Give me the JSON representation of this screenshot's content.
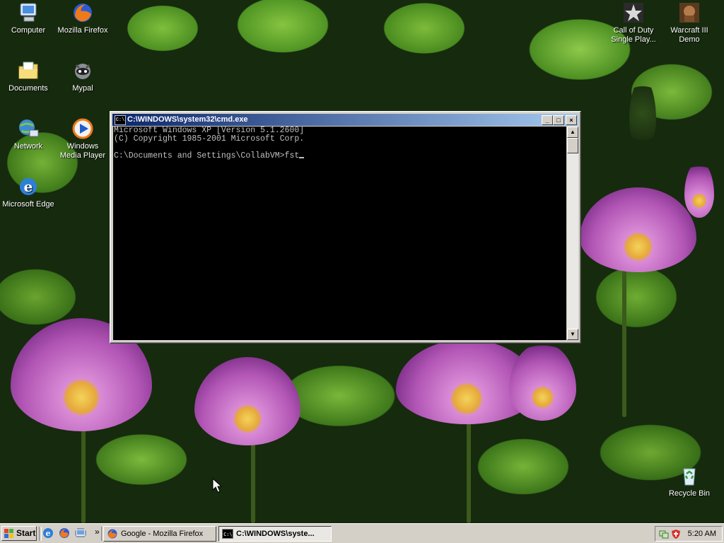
{
  "desktop": {
    "icons_left": [
      {
        "label": "Computer",
        "icon": "computer-icon"
      },
      {
        "label": "Mozilla Firefox",
        "icon": "firefox-icon"
      },
      {
        "label": "Documents",
        "icon": "documents-icon"
      },
      {
        "label": "Mypal",
        "icon": "mypal-icon"
      },
      {
        "label": "Network",
        "icon": "network-icon"
      },
      {
        "label": "Windows Media Player",
        "icon": "media-player-icon"
      },
      {
        "label": "Microsoft Edge",
        "icon": "edge-icon"
      }
    ],
    "icons_right": [
      {
        "label": "Call of Duty Single Play...",
        "icon": "call-of-duty-icon"
      },
      {
        "label": "Warcraft III Demo",
        "icon": "warcraft-icon"
      },
      {
        "label": "Recycle Bin",
        "icon": "recycle-bin-icon"
      }
    ]
  },
  "window": {
    "title": "C:\\WINDOWS\\system32\\cmd.exe",
    "console_lines": [
      "Microsoft Windows XP [Version 5.1.2600]",
      "(C) Copyright 1985-2001 Microsoft Corp.",
      "",
      "C:\\Documents and Settings\\CollabVM>fst"
    ],
    "controls": {
      "minimize": "_",
      "maximize": "□",
      "close": "×"
    }
  },
  "taskbar": {
    "start_label": "Start",
    "quick_launch": [
      "ie-icon",
      "firefox-icon",
      "show-desktop-icon"
    ],
    "overflow": "»",
    "tasks": [
      {
        "label": "Google - Mozilla Firefox",
        "active": false
      },
      {
        "label": "C:\\WINDOWS\\syste...",
        "active": true
      }
    ],
    "clock": "5:20 AM"
  },
  "colors": {
    "titlebar_start": "#0a246a",
    "titlebar_end": "#a6caf0",
    "console_bg": "#000000",
    "console_fg": "#c0c0c0",
    "taskbar": "#d4d0c8"
  }
}
